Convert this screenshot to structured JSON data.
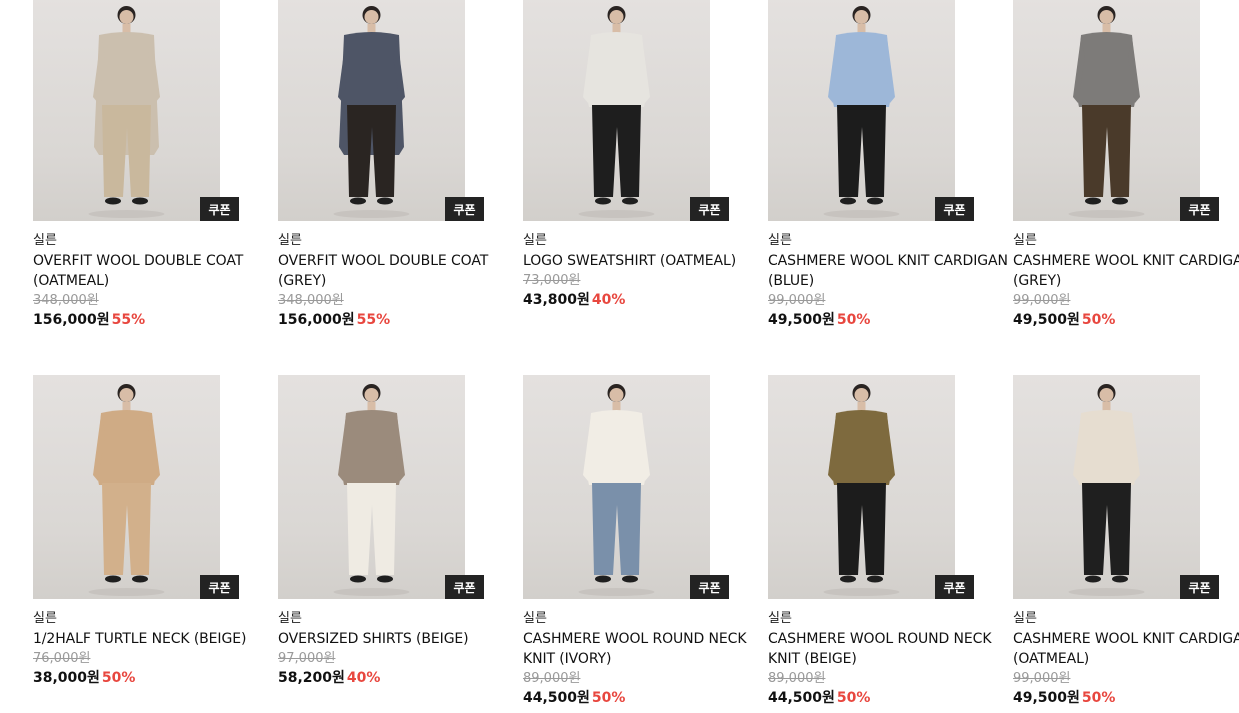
{
  "products": [
    {
      "brand": "실른",
      "name": "OVERFIT WOOL DOUBLE COAT (OATMEAL)",
      "original_price": "348,000원",
      "sale_price": "156,000원",
      "discount": "55%",
      "coupon": "쿠폰",
      "top_color": "#cbbfae",
      "bottom_color": "#c9b89d",
      "long_coat": true
    },
    {
      "brand": "실른",
      "name": "OVERFIT WOOL DOUBLE COAT (GREY)",
      "original_price": "348,000원",
      "sale_price": "156,000원",
      "discount": "55%",
      "coupon": "쿠폰",
      "top_color": "#4e5566",
      "bottom_color": "#2a2522",
      "long_coat": true
    },
    {
      "brand": "실른",
      "name": "LOGO SWEATSHIRT (OATMEAL)",
      "original_price": "73,000원",
      "sale_price": "43,800원",
      "discount": "40%",
      "coupon": "쿠폰",
      "top_color": "#e6e4df",
      "bottom_color": "#1e1e1e",
      "long_coat": false
    },
    {
      "brand": "실른",
      "name": "CASHMERE WOOL KNIT CARDIGAN (BLUE)",
      "original_price": "99,000원",
      "sale_price": "49,500원",
      "discount": "50%",
      "coupon": "쿠폰",
      "top_color": "#9db7d8",
      "bottom_color": "#1c1c1c",
      "long_coat": false
    },
    {
      "brand": "실른",
      "name": "CASHMERE WOOL KNIT CARDIGAN (GREY)",
      "original_price": "99,000원",
      "sale_price": "49,500원",
      "discount": "50%",
      "coupon": "쿠폰",
      "top_color": "#7d7b79",
      "bottom_color": "#4a3a2a",
      "long_coat": false
    },
    {
      "brand": "실른",
      "name": "1/2HALF TURTLE NECK (BEIGE)",
      "original_price": "76,000원",
      "sale_price": "38,000원",
      "discount": "50%",
      "coupon": "쿠폰",
      "top_color": "#cfab85",
      "bottom_color": "#d2b08b",
      "long_coat": false
    },
    {
      "brand": "실른",
      "name": "OVERSIZED SHIRTS (BEIGE)",
      "original_price": "97,000원",
      "sale_price": "58,200원",
      "discount": "40%",
      "coupon": "쿠폰",
      "top_color": "#9b8b7c",
      "bottom_color": "#efebe3",
      "long_coat": false
    },
    {
      "brand": "실른",
      "name": "CASHMERE WOOL ROUND NECK KNIT (IVORY)",
      "original_price": "89,000원",
      "sale_price": "44,500원",
      "discount": "50%",
      "coupon": "쿠폰",
      "top_color": "#f1ede5",
      "bottom_color": "#7a90aa",
      "long_coat": false
    },
    {
      "brand": "실른",
      "name": "CASHMERE WOOL ROUND NECK KNIT (BEIGE)",
      "original_price": "89,000원",
      "sale_price": "44,500원",
      "discount": "50%",
      "coupon": "쿠폰",
      "top_color": "#7e6a3e",
      "bottom_color": "#1c1c1c",
      "long_coat": false
    },
    {
      "brand": "실른",
      "name": "CASHMERE WOOL KNIT CARDIGAN (OATMEAL)",
      "original_price": "99,000원",
      "sale_price": "49,500원",
      "discount": "50%",
      "coupon": "쿠폰",
      "top_color": "#e6ddd0",
      "bottom_color": "#1f1f1f",
      "long_coat": false
    }
  ]
}
